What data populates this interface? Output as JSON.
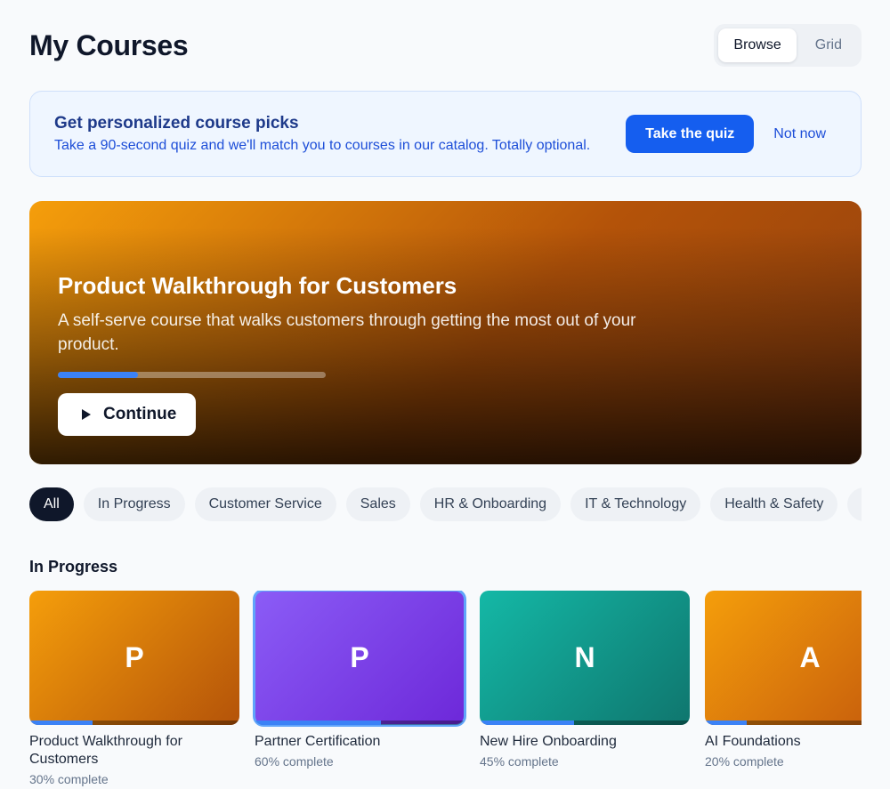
{
  "header": {
    "title": "My Courses",
    "view_options": [
      "Browse",
      "Grid"
    ],
    "active_view": "Browse"
  },
  "banner": {
    "title": "Get personalized course picks",
    "text": "Take a 90-second quiz and we'll match you to courses in our catalog. Totally optional.",
    "primary_label": "Take the quiz",
    "secondary_label": "Not now"
  },
  "hero": {
    "title": "Product Walkthrough for Customers",
    "description": "A self-serve course that walks customers through getting the most out of your product.",
    "progress_percent": 30,
    "button_label": "Continue",
    "button_icon": "play-icon",
    "gradient": [
      "#f59e0b",
      "#b45309"
    ]
  },
  "filters": {
    "chips": [
      "All",
      "In Progress",
      "Customer Service",
      "Sales",
      "HR & Onboarding",
      "IT & Technology",
      "Health & Safety",
      ""
    ],
    "active": "All"
  },
  "in_progress": {
    "title": "In Progress",
    "cards": [
      {
        "letter": "P",
        "title": "Product Walkthrough for Customers",
        "progress_text": "30% complete",
        "progress": 30,
        "colors": [
          "#f59e0b",
          "#b45309"
        ],
        "selected": false
      },
      {
        "letter": "P",
        "title": "Partner Certification",
        "progress_text": "60% complete",
        "progress": 60,
        "colors": [
          "#8b5cf6",
          "#6d28d9"
        ],
        "selected": true
      },
      {
        "letter": "N",
        "title": "New Hire Onboarding",
        "progress_text": "45% complete",
        "progress": 45,
        "colors": [
          "#14b8a6",
          "#0f766e"
        ],
        "selected": false
      },
      {
        "letter": "A",
        "title": "AI Foundations",
        "progress_text": "20% complete",
        "progress": 20,
        "colors": [
          "#f59e0b",
          "#c2570c"
        ],
        "selected": false
      }
    ]
  }
}
